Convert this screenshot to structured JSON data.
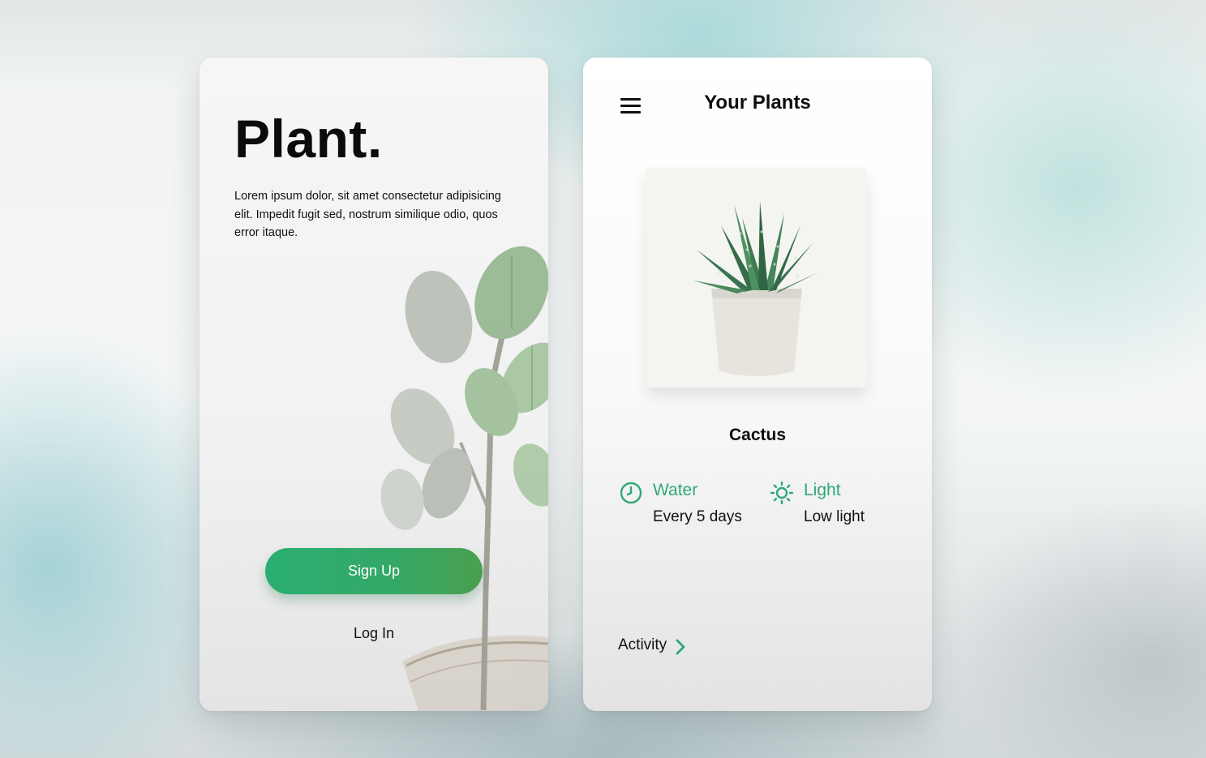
{
  "signup_screen": {
    "brand": "Plant.",
    "intro": "Lorem ipsum dolor, sit amet consectetur adipisicing elit. Impedit fugit sed, nostrum similique odio, quos error itaque.",
    "signup_label": "Sign Up",
    "login_label": "Log In",
    "illustration_icon": "fiddle-leaf-fig-icon"
  },
  "plants_screen": {
    "title": "Your Plants",
    "menu_icon": "hamburger-menu-icon",
    "plant": {
      "name": "Cactus",
      "photo_icon": "potted-succulent-icon"
    },
    "care": [
      {
        "label": "Water",
        "value": "Every 5 days",
        "icon": "clock-icon"
      },
      {
        "label": "Light",
        "value": "Low light",
        "icon": "sun-icon"
      }
    ],
    "activity_label": "Activity",
    "activity_icon": "chevron-right-icon"
  },
  "colors": {
    "accent": "#2fa877",
    "button_start": "#2bae72",
    "button_end": "#4a9f4e",
    "text": "#111111"
  }
}
